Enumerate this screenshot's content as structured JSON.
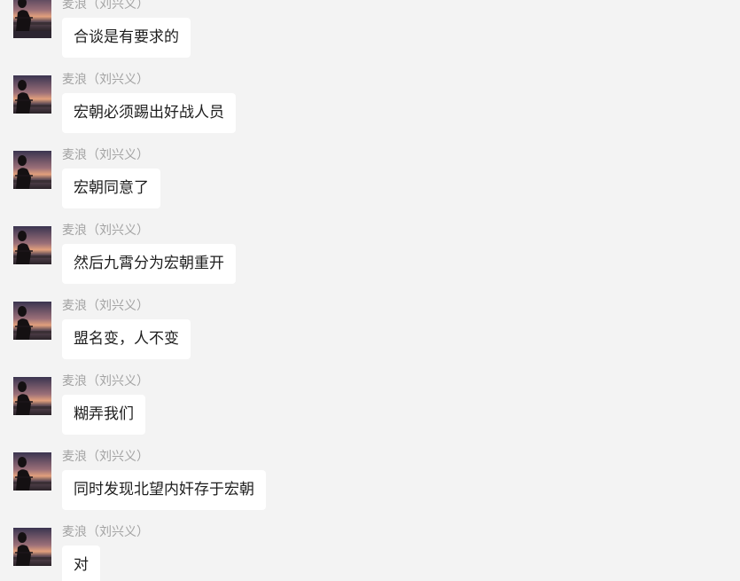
{
  "messages": [
    {
      "sender": "麦浪（刘兴义）",
      "text": "合谈是有要求的"
    },
    {
      "sender": "麦浪（刘兴义）",
      "text": "宏朝必须踢出好战人员"
    },
    {
      "sender": "麦浪（刘兴义）",
      "text": "宏朝同意了"
    },
    {
      "sender": "麦浪（刘兴义）",
      "text": "然后九霄分为宏朝重开"
    },
    {
      "sender": "麦浪（刘兴义）",
      "text": "盟名变，人不变"
    },
    {
      "sender": "麦浪（刘兴义）",
      "text": "糊弄我们"
    },
    {
      "sender": "麦浪（刘兴义）",
      "text": "同时发现北望内奸存于宏朝"
    },
    {
      "sender": "麦浪（刘兴义）",
      "text": "对"
    }
  ],
  "colors": {
    "background": "#f3f3f3",
    "bubble": "#ffffff",
    "sender_text": "#a3a3a3",
    "message_text": "#1e1e1e"
  }
}
